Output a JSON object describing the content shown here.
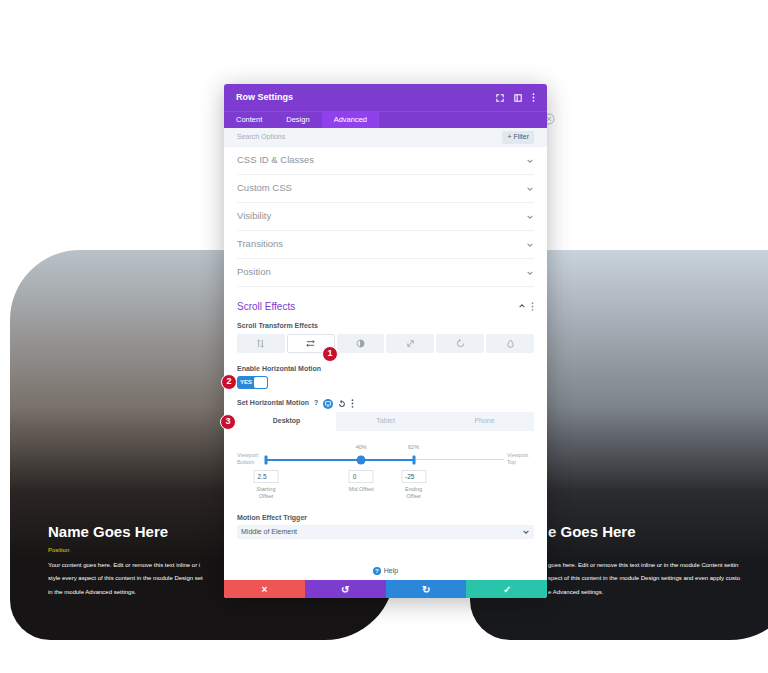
{
  "modal": {
    "title": "Row Settings",
    "tabs": [
      {
        "label": "Content",
        "selected": false
      },
      {
        "label": "Design",
        "selected": false
      },
      {
        "label": "Advanced",
        "selected": true
      }
    ],
    "search": {
      "placeholder": "Search Options",
      "filter": "+ Filter"
    },
    "sections": [
      {
        "label": "CSS ID & Classes",
        "expanded": false
      },
      {
        "label": "Custom CSS",
        "expanded": false
      },
      {
        "label": "Visibility",
        "expanded": false
      },
      {
        "label": "Transitions",
        "expanded": false
      },
      {
        "label": "Position",
        "expanded": false
      }
    ],
    "scroll_effects": {
      "title": "Scroll Effects",
      "expanded": true,
      "transform_label": "Scroll Transform Effects",
      "effects": [
        {
          "selected": false
        },
        {
          "selected": true
        },
        {
          "selected": false
        },
        {
          "selected": false
        },
        {
          "selected": false
        },
        {
          "selected": false
        }
      ],
      "horizontal_label": "Enable Horizontal Motion",
      "toggle": {
        "label": "YES",
        "on": true
      },
      "set_label": "Set Horizontal Motion",
      "help_icon": "?",
      "devices": [
        {
          "label": "Desktop",
          "selected": true
        },
        {
          "label": "Tablet",
          "selected": false
        },
        {
          "label": "Phone",
          "selected": false
        }
      ],
      "slider": {
        "left_label": "Viewport Bottom",
        "right_label": "Viewport Top",
        "handles": [
          {
            "level": 0,
            "value": "2.5",
            "caption": "Starting Offset"
          },
          {
            "level": 0.4,
            "percent": "40%",
            "value": "0",
            "caption": "Mid Offset"
          },
          {
            "level": 0.62,
            "percent": "62%",
            "value": "-25",
            "caption": "Ending Offset"
          }
        ]
      },
      "trigger_label": "Motion Effect Trigger",
      "trigger_value": "Middle of Element"
    },
    "help": {
      "icon": "?",
      "label": "Help"
    },
    "buttons": [
      {
        "label": "×",
        "color": "#ef5555"
      },
      {
        "label": "↺",
        "color": "#7e3bd0"
      },
      {
        "label": "↻",
        "color": "#2b87da"
      },
      {
        "label": "✓",
        "color": "#29c4a9"
      }
    ]
  },
  "badges": [
    "1",
    "2",
    "3"
  ],
  "cards": [
    {
      "name": "Name Goes Here",
      "position": "Position",
      "lines": [
        "Your content goes here. Edit or remove this text inline or i",
        "style every aspect of this content in the module Design set",
        "in the module Advanced settings."
      ]
    },
    {
      "name": "e Goes Here",
      "lines": [
        "goes here. Edit or remove this text inline or in the module Content settin",
        "spect of this content in the module Design settings and even apply custo",
        "e Advanced settings."
      ]
    }
  ]
}
